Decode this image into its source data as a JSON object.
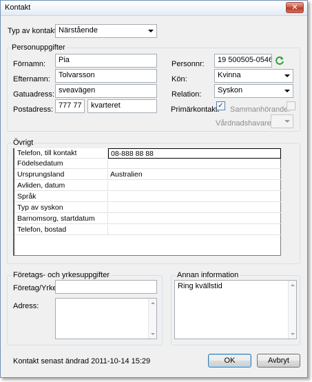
{
  "window": {
    "title": "Kontakt",
    "close_glyph": "✕"
  },
  "contact_type": {
    "label": "Typ av kontakt:",
    "value": "Närstående"
  },
  "personal": {
    "group_title": "Personuppgifter",
    "first_name": {
      "label": "Förnamn:",
      "value": "Pia"
    },
    "last_name": {
      "label": "Efternamn:",
      "value": "Tolvarsson"
    },
    "street": {
      "label": "Gatuadress:",
      "value": "sveavägen"
    },
    "postal": {
      "label": "Postadress:",
      "zip": "777 77",
      "city": "kvarteret"
    },
    "person_nr": {
      "label": "Personnr:",
      "value": "19 500505-0546"
    },
    "gender": {
      "label": "Kön:",
      "value": "Kvinna"
    },
    "relation": {
      "label": "Relation:",
      "value": "Syskon"
    },
    "primary_contact": {
      "label": "Primärkontakt:",
      "checked": true
    },
    "cohabiting": {
      "label": "Sammanhörande:",
      "checked": false
    },
    "guardian": {
      "label": "Vårdnadshavare:",
      "value": ""
    }
  },
  "other": {
    "group_title": "Övrigt",
    "rows": [
      {
        "name": "Telefon, till kontakt",
        "value": "08-888 88 88"
      },
      {
        "name": "Födelsedatum",
        "value": ""
      },
      {
        "name": "Ursprungsland",
        "value": "Australien"
      },
      {
        "name": "Avliden, datum",
        "value": ""
      },
      {
        "name": "Språk",
        "value": ""
      },
      {
        "name": "Typ av syskon",
        "value": ""
      },
      {
        "name": "Barnomsorg, startdatum",
        "value": ""
      },
      {
        "name": "Telefon, bostad",
        "value": ""
      }
    ]
  },
  "company": {
    "group_title": "Företags- och yrkesuppgifter",
    "company_label": "Företag/Yrke:",
    "company_value": "",
    "address_label": "Adress:",
    "address_value": ""
  },
  "info": {
    "group_title": "Annan information",
    "text": "Ring kvällstid"
  },
  "footer": {
    "last_changed": "Kontakt senast ändrad 2011-10-14 15:29",
    "ok_label": "OK",
    "cancel_label": "Avbryt"
  },
  "colors": {
    "accent": "#3c7fb1",
    "refresh": "#2e9e3a"
  }
}
